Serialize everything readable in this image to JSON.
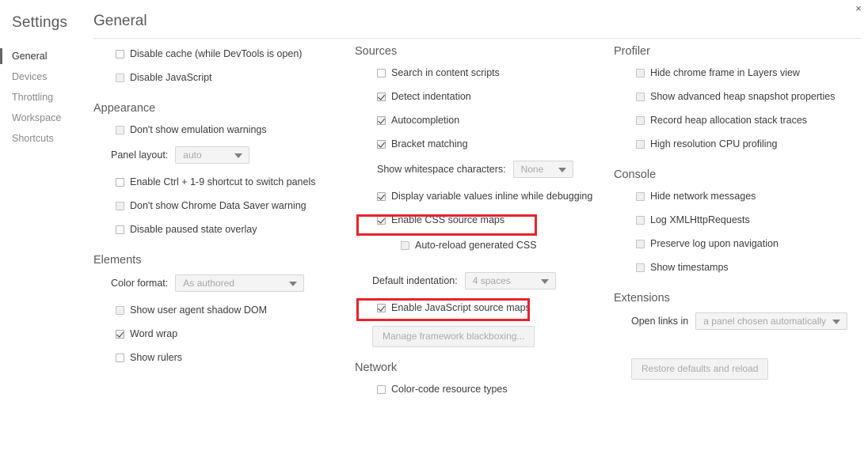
{
  "window": {
    "close_label": "×"
  },
  "sidebar": {
    "title": "Settings",
    "items": [
      {
        "label": "General",
        "selected": true
      },
      {
        "label": "Devices",
        "selected": false
      },
      {
        "label": "Throttling",
        "selected": false
      },
      {
        "label": "Workspace",
        "selected": false
      },
      {
        "label": "Shortcuts",
        "selected": false
      }
    ]
  },
  "main": {
    "title": "General"
  },
  "col1": {
    "top_checkboxes": [
      {
        "label": "Disable cache (while DevTools is open)",
        "checked": false,
        "dim": false
      },
      {
        "label": "Disable JavaScript",
        "checked": false,
        "dim": true
      }
    ],
    "appearance": {
      "title": "Appearance",
      "cb_emulation": {
        "label": "Don't show emulation warnings",
        "checked": false,
        "dim": true
      },
      "panel_layout": {
        "label": "Panel layout:",
        "value": "auto"
      },
      "cb_ctrl": {
        "label": "Enable Ctrl + 1-9 shortcut to switch panels",
        "checked": false,
        "dim": false
      },
      "cb_saver": {
        "label": "Don't show Chrome Data Saver warning",
        "checked": false,
        "dim": true
      },
      "cb_paused": {
        "label": "Disable paused state overlay",
        "checked": false,
        "dim": false
      }
    },
    "elements": {
      "title": "Elements",
      "color_format": {
        "label": "Color format:",
        "value": "As authored"
      },
      "cb_shadow": {
        "label": "Show user agent shadow DOM",
        "checked": false,
        "dim": true
      },
      "cb_wordwrap": {
        "label": "Word wrap",
        "checked": true,
        "dim": false
      },
      "cb_rulers": {
        "label": "Show rulers",
        "checked": false,
        "dim": false
      }
    }
  },
  "col2": {
    "sources": {
      "title": "Sources",
      "cb_search": {
        "label": "Search in content scripts",
        "checked": false,
        "dim": false
      },
      "cb_indent": {
        "label": "Detect indentation",
        "checked": true,
        "dim": false
      },
      "cb_autocomp": {
        "label": "Autocompletion",
        "checked": true,
        "dim": false
      },
      "cb_bracket": {
        "label": "Bracket matching",
        "checked": true,
        "dim": false
      },
      "whitespace": {
        "label": "Show whitespace characters:",
        "value": "None"
      },
      "cb_inline": {
        "label": "Display variable values inline while debugging",
        "checked": true,
        "dim": false
      },
      "cb_cssmaps": {
        "label": "Enable CSS source maps",
        "checked": true,
        "dim": false
      },
      "cb_autoreload": {
        "label": "Auto-reload generated CSS",
        "checked": false,
        "dim": true
      },
      "default_indent": {
        "label": "Default indentation:",
        "value": "4 spaces"
      },
      "cb_jsmaps": {
        "label": "Enable JavaScript source maps",
        "checked": true,
        "dim": false
      },
      "btn_blackbox": "Manage framework blackboxing..."
    },
    "network": {
      "title": "Network",
      "cb_colorcode": {
        "label": "Color-code resource types",
        "checked": false,
        "dim": false
      }
    }
  },
  "col3": {
    "profiler": {
      "title": "Profiler",
      "cb_hideframe": {
        "label": "Hide chrome frame in Layers view",
        "checked": false,
        "dim": true
      },
      "cb_heapprops": {
        "label": "Show advanced heap snapshot properties",
        "checked": false,
        "dim": true
      },
      "cb_heaptrace": {
        "label": "Record heap allocation stack traces",
        "checked": false,
        "dim": true
      },
      "cb_cpuprof": {
        "label": "High resolution CPU profiling",
        "checked": false,
        "dim": true
      }
    },
    "console": {
      "title": "Console",
      "cb_hidenet": {
        "label": "Hide network messages",
        "checked": false,
        "dim": true
      },
      "cb_xhr": {
        "label": "Log XMLHttpRequests",
        "checked": false,
        "dim": true
      },
      "cb_preserve": {
        "label": "Preserve log upon navigation",
        "checked": false,
        "dim": true
      },
      "cb_timestamps": {
        "label": "Show timestamps",
        "checked": false,
        "dim": true
      }
    },
    "extensions": {
      "title": "Extensions",
      "open_links": {
        "label": "Open links in",
        "value": "a panel chosen automatically"
      },
      "btn_restore": "Restore defaults and reload"
    }
  },
  "highlights": {
    "accent_color": "#e8232a",
    "boxes": [
      "Enable CSS source maps",
      "Enable JavaScript source maps"
    ]
  }
}
